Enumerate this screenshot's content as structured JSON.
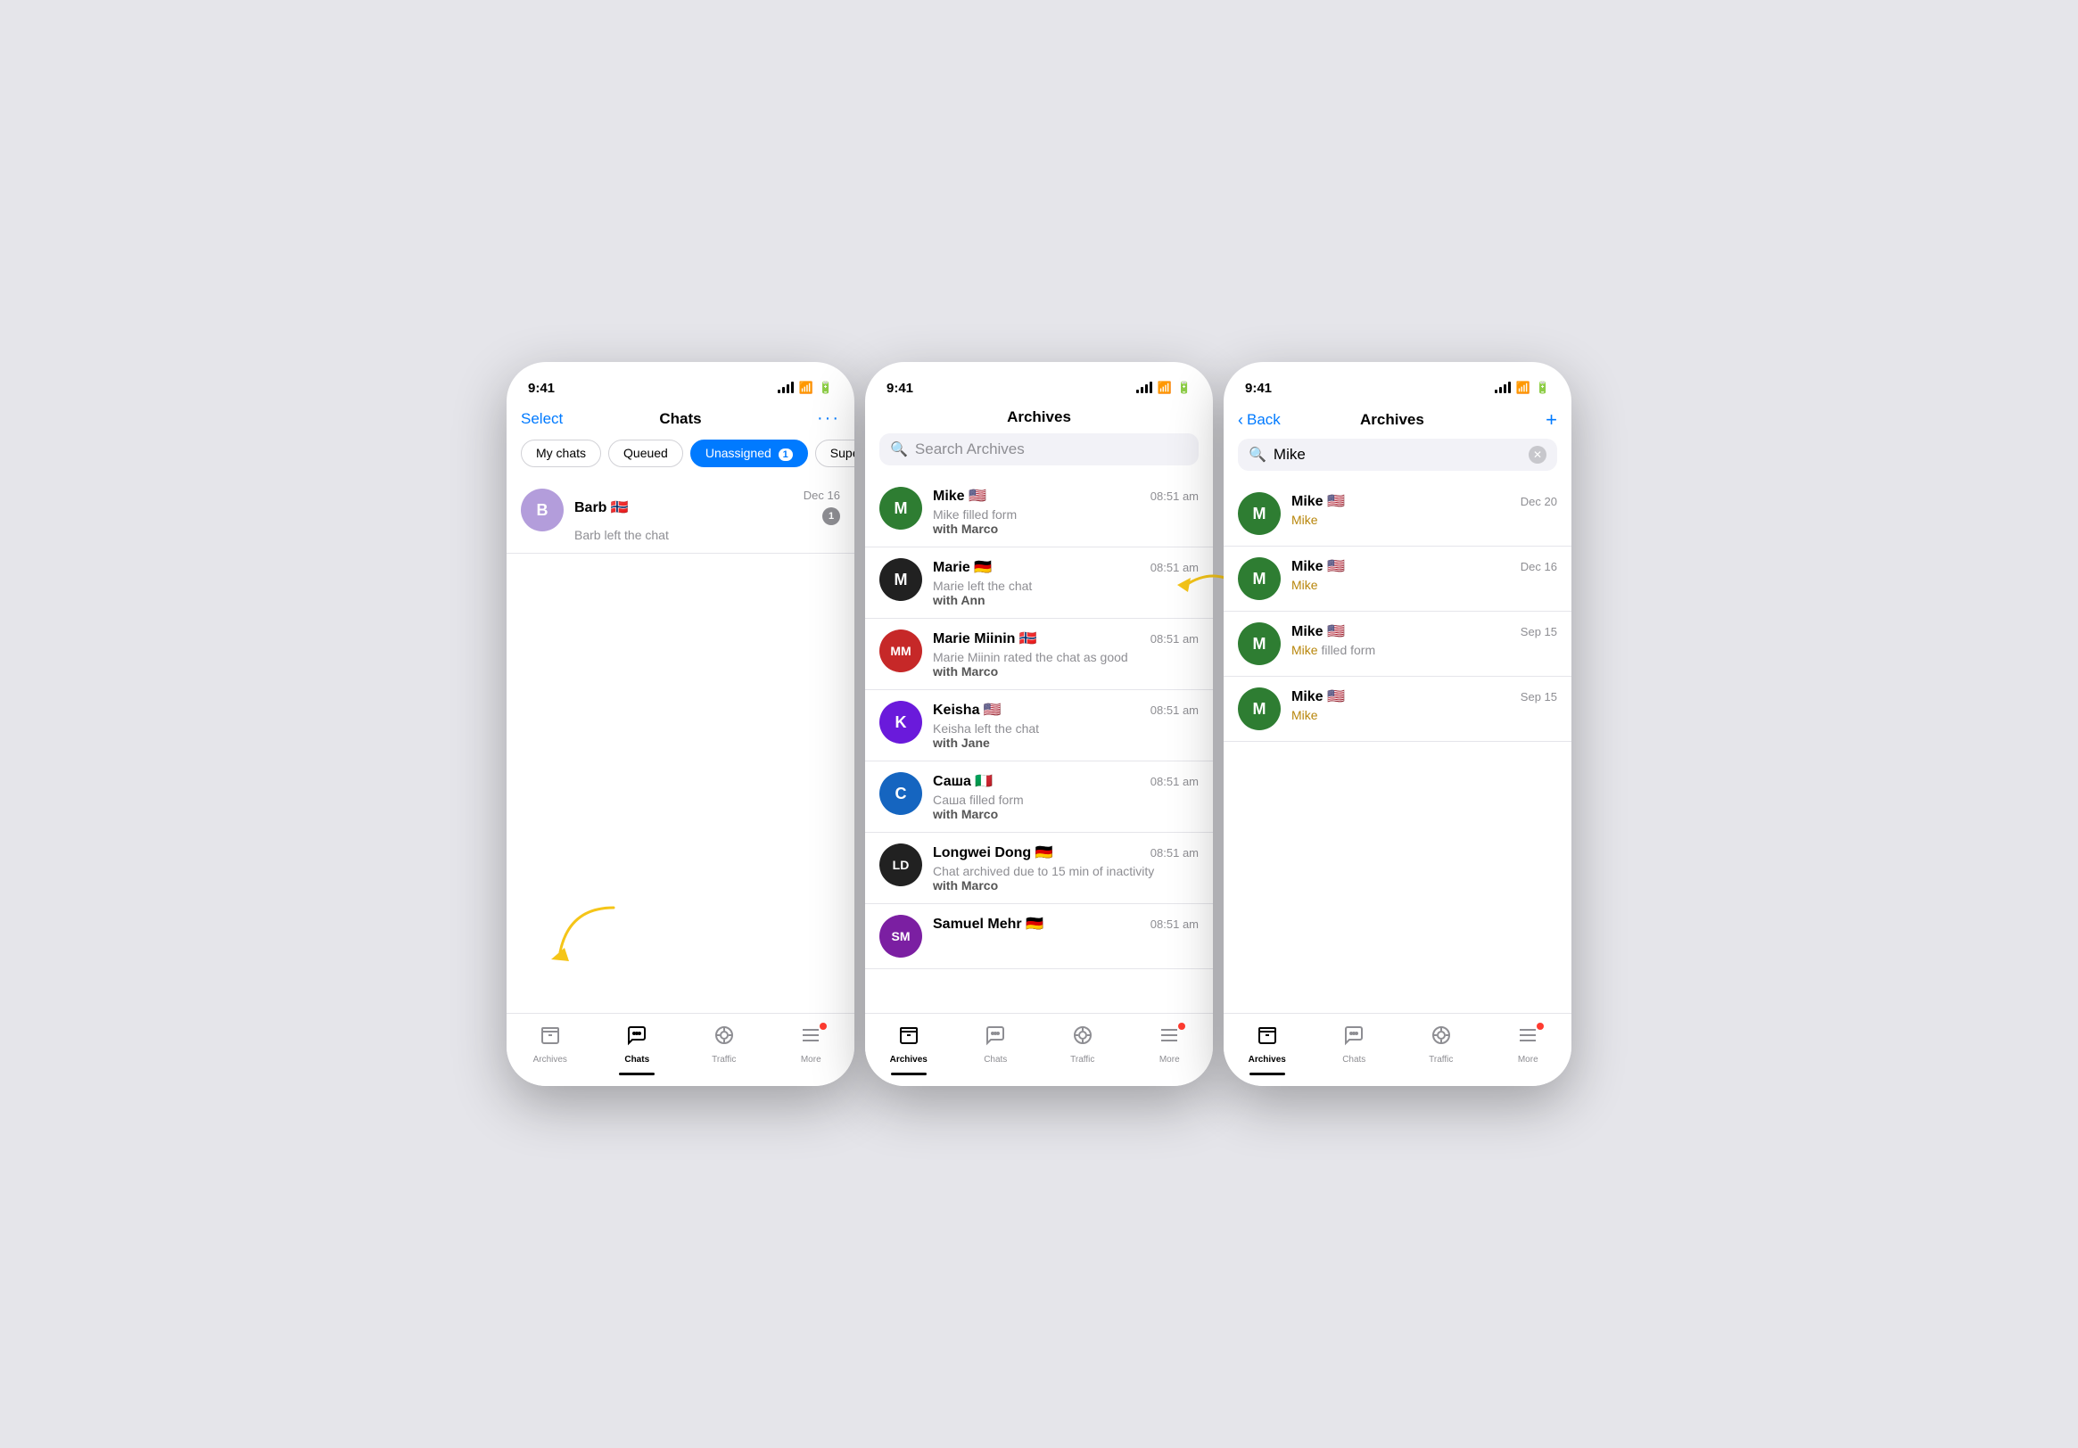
{
  "phone1": {
    "time": "9:41",
    "header": {
      "left": "Select",
      "title": "Chats",
      "right": "···"
    },
    "tabs": [
      {
        "label": "My chats",
        "active": false
      },
      {
        "label": "Queued",
        "active": false
      },
      {
        "label": "Unassigned",
        "active": true,
        "badge": "1"
      },
      {
        "label": "Supervise",
        "active": false
      }
    ],
    "chats": [
      {
        "name": "Barb 🇳🇴",
        "avatar_text": "B",
        "avatar_color": "#b39ddb",
        "preview_line1": "Barb left the chat",
        "preview_line2": "",
        "time": "Dec 16",
        "badge": "1"
      }
    ],
    "nav": [
      {
        "label": "Archives",
        "icon": "🗄",
        "active": false
      },
      {
        "label": "Chats",
        "icon": "💬",
        "active": true
      },
      {
        "label": "Traffic",
        "icon": "🎯",
        "active": false
      },
      {
        "label": "More",
        "icon": "☰",
        "active": false,
        "dot": true
      }
    ]
  },
  "phone2": {
    "time": "9:41",
    "header": {
      "title": "Archives"
    },
    "search_placeholder": "Search Archives",
    "chats": [
      {
        "name": "Mike 🇺🇸",
        "avatar_text": "M",
        "avatar_color": "#2e7d32",
        "preview_line1": "Mike filled form",
        "preview_bold": "with Marco",
        "time": "08:51 am"
      },
      {
        "name": "Marie 🇩🇪",
        "avatar_text": "M",
        "avatar_color": "#212121",
        "preview_line1": "Marie left the chat",
        "preview_bold": "with Ann",
        "time": "08:51 am"
      },
      {
        "name": "Marie Miinin 🇳🇴",
        "avatar_text": "MM",
        "avatar_color": "#c62828",
        "preview_line1": "Marie Miinin rated the chat as good",
        "preview_bold": "with Marco",
        "time": "08:51 am"
      },
      {
        "name": "Keisha 🇺🇸",
        "avatar_text": "K",
        "avatar_color": "#6a1adb",
        "preview_line1": "Keisha left the chat",
        "preview_bold": "with Jane",
        "time": "08:51 am"
      },
      {
        "name": "Саша 🇮🇹",
        "avatar_text": "C",
        "avatar_color": "#1565c0",
        "preview_line1": "Саша filled form",
        "preview_bold": "with Marco",
        "time": "08:51 am"
      },
      {
        "name": "Longwei Dong 🇩🇪",
        "avatar_text": "LD",
        "avatar_color": "#212121",
        "preview_line1": "Chat archived due to 15 min of inactivity",
        "preview_bold": "with Marco",
        "time": "08:51 am"
      },
      {
        "name": "Samuel Mehr 🇩🇪",
        "avatar_text": "SM",
        "avatar_color": "#7b1fa2",
        "preview_line1": "",
        "preview_bold": "",
        "time": "08:51 am"
      }
    ],
    "nav": [
      {
        "label": "Archives",
        "icon": "🗄",
        "active": true
      },
      {
        "label": "Chats",
        "icon": "💬",
        "active": false
      },
      {
        "label": "Traffic",
        "icon": "🎯",
        "active": false
      },
      {
        "label": "More",
        "icon": "☰",
        "active": false,
        "dot": true
      }
    ]
  },
  "phone3": {
    "time": "9:41",
    "header": {
      "left": "Back",
      "title": "Archives",
      "right": "+"
    },
    "search_value": "Mike",
    "chats": [
      {
        "name": "Mike 🇺🇸",
        "avatar_text": "M",
        "avatar_color": "#2e7d32",
        "preview_line1": "Mike",
        "preview_bold": "",
        "time": "Dec 20"
      },
      {
        "name": "Mike 🇺🇸",
        "avatar_text": "M",
        "avatar_color": "#2e7d32",
        "preview_line1": "Mike",
        "preview_bold": "",
        "time": "Dec 16"
      },
      {
        "name": "Mike 🇺🇸",
        "avatar_text": "M",
        "avatar_color": "#2e7d32",
        "preview_line1_highlight": "Mike",
        "preview_after": " filled form",
        "preview_bold": "",
        "time": "Sep 15"
      },
      {
        "name": "Mike 🇺🇸",
        "avatar_text": "M",
        "avatar_color": "#2e7d32",
        "preview_line1": "Mike",
        "preview_bold": "",
        "time": "Sep 15"
      }
    ],
    "nav": [
      {
        "label": "Archives",
        "icon": "🗄",
        "active": true
      },
      {
        "label": "Chats",
        "icon": "💬",
        "active": false
      },
      {
        "label": "Traffic",
        "icon": "🎯",
        "active": false
      },
      {
        "label": "More",
        "icon": "☰",
        "active": false,
        "dot": true
      }
    ]
  }
}
